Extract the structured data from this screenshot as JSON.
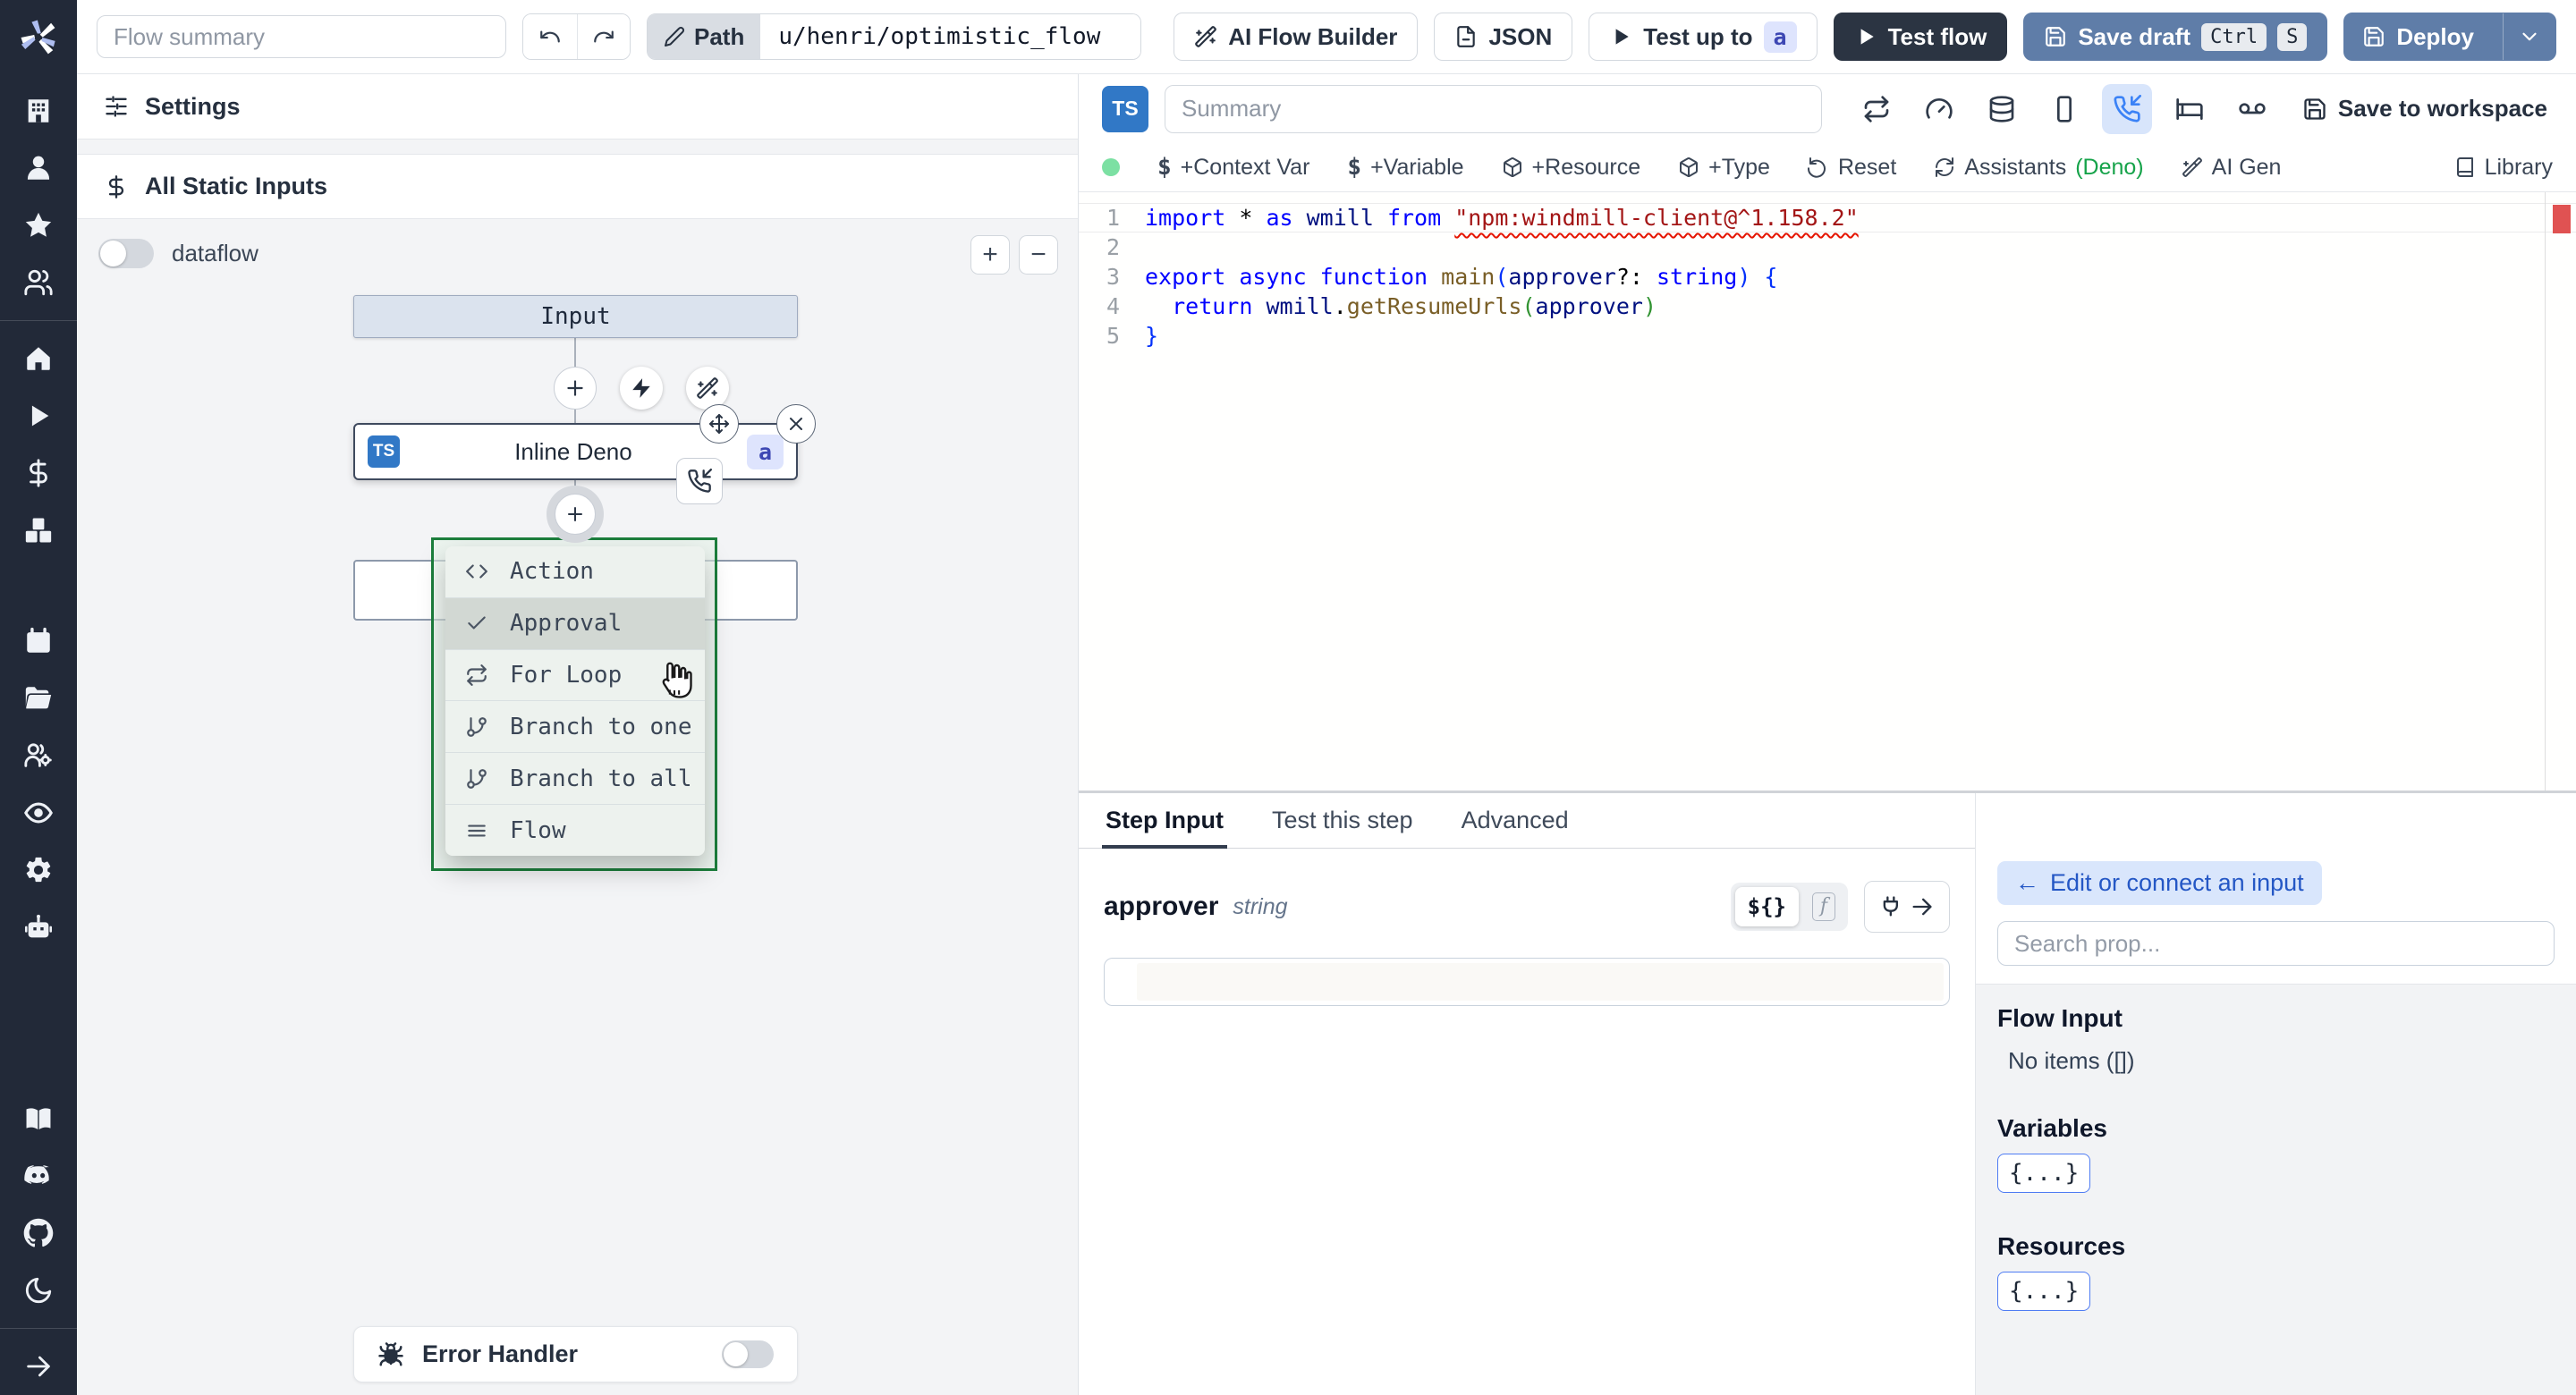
{
  "colors": {
    "accent_blue": "#3b82f6",
    "slate_button_blue": "#5f7da8",
    "dark_button": "#2b3442",
    "menu_selection_green": "#1c7e3c",
    "ts_badge_blue": "#3178c6",
    "error_marker_red": "#e05252",
    "deno_green": "#16a34a"
  },
  "topbar": {
    "flow_summary_placeholder": "Flow summary",
    "path_label": "Path",
    "path_value": "u/henri/optimistic_flow",
    "ai_flow_builder": "AI Flow Builder",
    "json_label": "JSON",
    "test_up_to": "Test up to",
    "test_up_to_badge": "a",
    "test_flow": "Test flow",
    "save_draft": "Save draft",
    "kbd_ctrl": "Ctrl",
    "kbd_s": "S",
    "deploy": "Deploy"
  },
  "flow_panel": {
    "settings": "Settings",
    "all_static_inputs": "All Static Inputs",
    "dataflow": "dataflow",
    "zoom_in": "+",
    "zoom_out": "−",
    "input_node": "Input",
    "step_lang_badge": "TS",
    "step_title": "Inline Deno",
    "step_id_badge": "a",
    "menu": {
      "items": [
        {
          "label": "Action"
        },
        {
          "label": "Approval"
        },
        {
          "label": "For Loop"
        },
        {
          "label": "Branch to one"
        },
        {
          "label": "Branch to all"
        },
        {
          "label": "Flow"
        }
      ]
    },
    "error_handler": "Error Handler"
  },
  "editor": {
    "ts_badge": "TS",
    "summary_placeholder": "Summary",
    "save_to_workspace": "Save to workspace",
    "toolbar": {
      "items": [
        {
          "icon": "dollar",
          "label": "+Context Var"
        },
        {
          "icon": "dollar",
          "label": "+Variable"
        },
        {
          "icon": "package",
          "label": "+Resource"
        },
        {
          "icon": "package",
          "label": "+Type"
        },
        {
          "icon": "rotate-ccw",
          "label": "Reset"
        },
        {
          "icon": "refresh",
          "label": "Assistants",
          "suffix": "(Deno)"
        },
        {
          "icon": "wand",
          "label": "AI Gen"
        }
      ],
      "library": "Library"
    },
    "code": {
      "line_numbers": [
        "1",
        "2",
        "3",
        "4",
        "5"
      ],
      "l1": [
        "import ",
        "* ",
        "as ",
        "wmill ",
        "from ",
        "\"npm:windmill-client@^1.158.2\""
      ],
      "l3": [
        "export ",
        "async ",
        "function ",
        "main",
        "(",
        "approver",
        "?: ",
        "string",
        ") {"
      ],
      "l4": [
        "  return ",
        "wmill",
        ".",
        "getResumeUrls",
        "(",
        "approver",
        ")"
      ],
      "l5": [
        "}"
      ]
    }
  },
  "step_panel": {
    "tabs": [
      "Step Input",
      "Test this step",
      "Advanced"
    ],
    "field_name": "approver",
    "field_type": "string",
    "expr_toggle": "${}",
    "fn_toggle": "f"
  },
  "connect_panel": {
    "back_arrow": "←",
    "edit_label": "Edit or connect an input",
    "search_placeholder": "Search prop...",
    "flow_input_title": "Flow Input",
    "flow_input_empty": "No items ([])",
    "variables_title": "Variables",
    "resources_title": "Resources",
    "object_chip": "{...}"
  }
}
